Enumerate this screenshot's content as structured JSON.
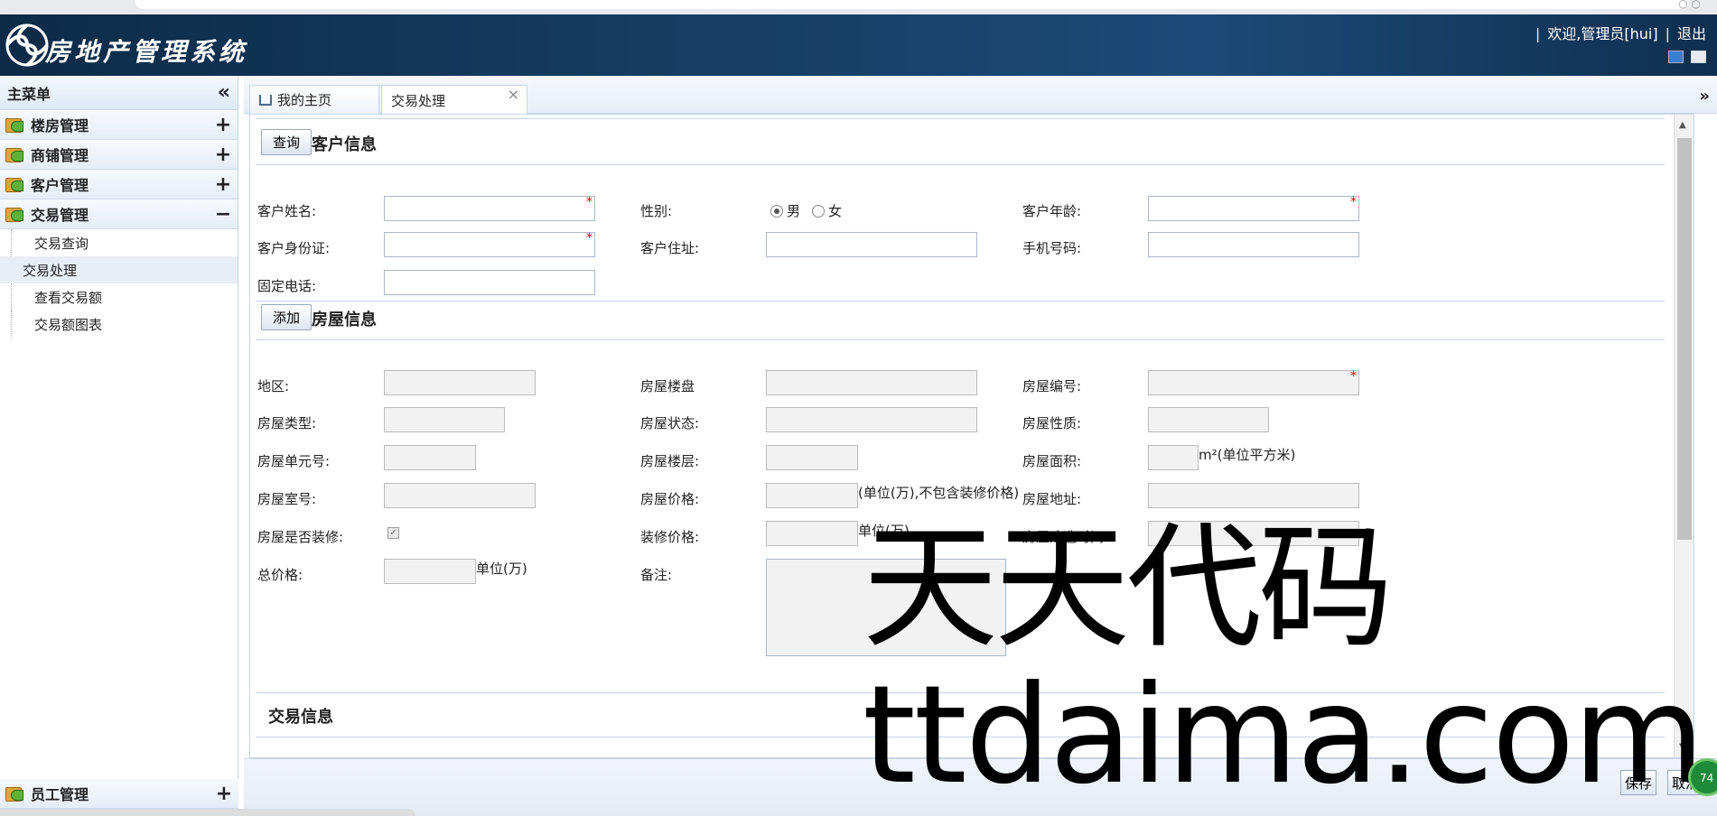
{
  "app": {
    "brand": "房地产管理系统"
  },
  "header": {
    "welcome": "欢迎,管理员[hui]",
    "logout": "退出"
  },
  "sidebar": {
    "title": "主菜单",
    "collapse_icon": "«",
    "groups": [
      {
        "label": "楼房管理",
        "toggle": "+"
      },
      {
        "label": "商铺管理",
        "toggle": "+"
      },
      {
        "label": "客户管理",
        "toggle": "+"
      },
      {
        "label": "交易管理",
        "toggle": "−"
      }
    ],
    "subitems": [
      "交易查询",
      "交易处理",
      "查看交易额",
      "交易额图表"
    ],
    "bottom_group": {
      "label": "员工管理",
      "toggle": "+"
    }
  },
  "tabs": [
    {
      "label": "我的主页"
    },
    {
      "label": "交易处理",
      "close": "×"
    }
  ],
  "tab_more": "»",
  "customer": {
    "query_btn": "查询",
    "title": "客户信息",
    "name_label": "客户姓名:",
    "gender_label": "性别:",
    "male": "男",
    "female": "女",
    "age_label": "客户年龄:",
    "id_label": "客户身份证:",
    "address_label": "客户住址:",
    "mobile_label": "手机号码:",
    "phone_label": "固定电话:",
    "required_mark": "*"
  },
  "house": {
    "add_btn": "添加",
    "title": "房屋信息",
    "area_label": "地区:",
    "estate_label": "房屋楼盘",
    "code_label": "房屋编号:",
    "type_label": "房屋类型:",
    "status_label": "房屋状态:",
    "nature_label": "房屋性质:",
    "unit_label": "房屋单元号:",
    "floor_label": "房屋楼层:",
    "size_label": "房屋面积:",
    "size_unit": "m²(单位平方米)",
    "room_label": "房屋室号:",
    "price_label": "房屋价格:",
    "price_unit": "(单位(万),不包含装修价格)",
    "addr_label": "房屋地址:",
    "decorated_label": "房屋是否装修:",
    "deco_price_label": "装修价格:",
    "deco_unit": "单位(万)",
    "build_time_label": "房屋建造时间:",
    "total_label": "总价格:",
    "total_unit": "单位(万)",
    "remark_label": "备注:"
  },
  "trade": {
    "title": "交易信息"
  },
  "footer": {
    "save": "保存",
    "cancel": "取消"
  },
  "watermark": {
    "line1": "天天代码",
    "line2": "ttdaima.com"
  },
  "fab": {
    "label": "74"
  }
}
